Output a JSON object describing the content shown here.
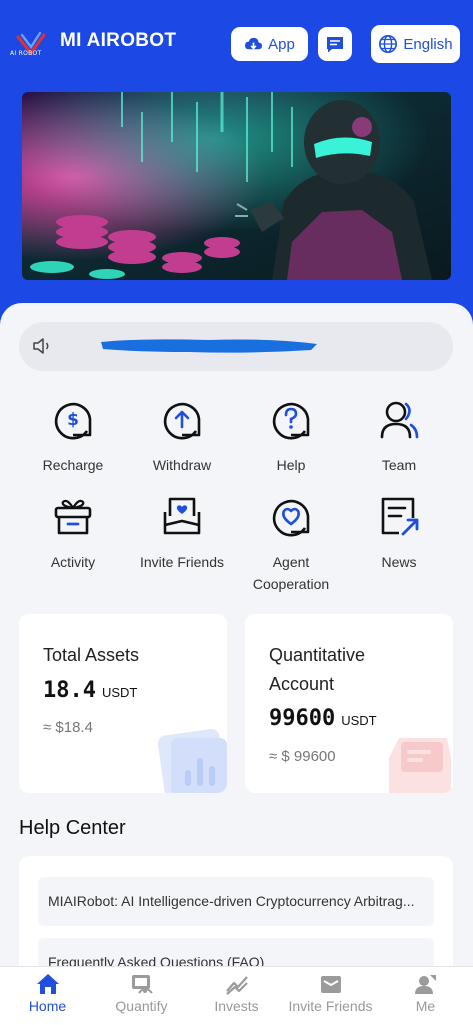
{
  "header": {
    "app_title": "MI AIROBOT",
    "logo_text": "AI ROBOT",
    "app_button_label": "App",
    "language_label": "English"
  },
  "colors": {
    "brand": "#1c48e6",
    "accent": "#1f4fdc"
  },
  "actions": [
    {
      "label": "Recharge",
      "icon": "dollar-circle-icon"
    },
    {
      "label": "Withdraw",
      "icon": "arrow-up-circle-icon"
    },
    {
      "label": "Help",
      "icon": "question-circle-icon"
    },
    {
      "label": "Team",
      "icon": "team-icon"
    },
    {
      "label": "Activity",
      "icon": "gift-icon"
    },
    {
      "label": "Invite Friends",
      "icon": "envelope-heart-icon"
    },
    {
      "label": "Agent Cooperation",
      "icon": "heart-circle-icon"
    },
    {
      "label": "News",
      "icon": "news-icon"
    }
  ],
  "assets": {
    "total": {
      "title": "Total Assets",
      "value": "18.4",
      "unit": "USDT",
      "approx": "≈ $18.4"
    },
    "quant": {
      "title": "Quantitative Account",
      "value": "99600",
      "unit": "USDT",
      "approx": "≈ $ 99600"
    }
  },
  "help": {
    "title": "Help Center",
    "items": [
      "MIAIRobot: AI Intelligence-driven Cryptocurrency Arbitrag...",
      "Frequently Asked Questions (FAQ)"
    ]
  },
  "tabs": [
    {
      "label": "Home",
      "icon": "home-icon",
      "active": true
    },
    {
      "label": "Quantify",
      "icon": "quantify-icon"
    },
    {
      "label": "Invests",
      "icon": "trend-icon"
    },
    {
      "label": "Invite Friends",
      "icon": "mail-icon"
    },
    {
      "label": "Me",
      "icon": "user-icon"
    }
  ]
}
